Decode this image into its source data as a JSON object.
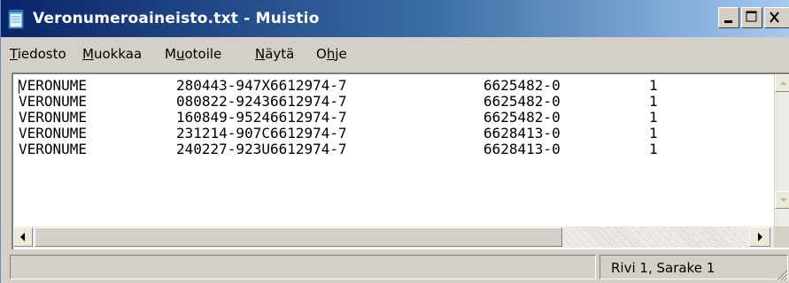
{
  "window": {
    "title": "Veronumeroaineisto.txt - Muistio",
    "icon": "notepad-icon",
    "controls": [
      "minimize-icon",
      "maximize-icon",
      "close-icon"
    ]
  },
  "menu": {
    "items": [
      {
        "label": "Tiedosto",
        "mnemonic": "T"
      },
      {
        "label": "Muokkaa",
        "mnemonic": "M"
      },
      {
        "label": "Muotoile",
        "mnemonic": "u"
      },
      {
        "label": "Näytä",
        "mnemonic": "N"
      },
      {
        "label": "Ohje",
        "mnemonic": "h"
      }
    ]
  },
  "document": {
    "rows": [
      {
        "c1": "VERONUME",
        "c2": "280443-947X6612974-7",
        "c3": "6625482-0",
        "c4": "1"
      },
      {
        "c1": "VERONUME",
        "c2": "080822-92436612974-7",
        "c3": "6625482-0",
        "c4": "1"
      },
      {
        "c1": "VERONUME",
        "c2": "160849-95246612974-7",
        "c3": "6625482-0",
        "c4": "1"
      },
      {
        "c1": "VERONUME",
        "c2": "231214-907C6612974-7",
        "c3": "6628413-0",
        "c4": "1"
      },
      {
        "c1": "VERONUME",
        "c2": "240227-923U6612974-7",
        "c3": "6628413-0",
        "c4": "1"
      }
    ]
  },
  "status": {
    "position": "Rivi 1, Sarake 1"
  },
  "colors": {
    "titlebar_start": "#0a246a",
    "titlebar_end": "#a6caf0",
    "chrome": "#d4d0c8"
  }
}
